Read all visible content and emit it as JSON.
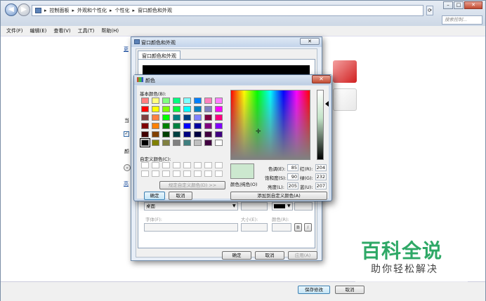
{
  "breadcrumb": [
    "控制面板",
    "外观和个性化",
    "个性化",
    "窗口颜色和外观"
  ],
  "search": {
    "placeholder": "搜索控制..."
  },
  "menu": [
    "文件(F)",
    "编辑(E)",
    "查看(V)",
    "工具(T)",
    "帮助(H)"
  ],
  "main_window": {
    "left_fragments": [
      "更",
      "当",
      "颜",
      "高"
    ],
    "save_label": "保存修改",
    "cancel_label": "取消"
  },
  "appearance_dialog": {
    "title": "窗口颜色和外观",
    "tab": "窗口颜色和外观",
    "item_value": "桌面",
    "font_label": "字体(F):",
    "size_label": "大小(E):",
    "color_label": "颜色(R):",
    "bold_label": "B",
    "italic_label": "I",
    "ok_label": "确定",
    "cancel_label": "取消",
    "apply_label": "应用(A)"
  },
  "color_dialog": {
    "title": "颜色",
    "basic_colors_label": "基本颜色(B):",
    "custom_colors_label": "自定义颜色(C):",
    "define_custom_label": "规定自定义颜色(D) >>",
    "ok_label": "确定",
    "cancel_label": "取消",
    "solid_label": "颜色|纯色(O)",
    "add_custom_label": "添加到自定义颜色(A)",
    "hue_label": "色调(E):",
    "hue_value": "85",
    "sat_label": "饱和度(S):",
    "sat_value": "90",
    "lum_label": "亮度(L):",
    "lum_value": "205",
    "red_label": "红(R):",
    "red_value": "204",
    "green_label": "绿(G):",
    "green_value": "232",
    "blue_label": "蓝(U):",
    "blue_value": "207",
    "basic_colors": [
      "#ff8080",
      "#ffff80",
      "#80ff80",
      "#00ff80",
      "#80ffff",
      "#0080ff",
      "#ff80c0",
      "#ff80ff",
      "#ff0000",
      "#ffff00",
      "#80ff00",
      "#00ff40",
      "#00ffff",
      "#0080c0",
      "#8080c0",
      "#ff00ff",
      "#804040",
      "#ff8040",
      "#00ff00",
      "#008080",
      "#004080",
      "#8080ff",
      "#800040",
      "#ff0080",
      "#800000",
      "#ff8000",
      "#008000",
      "#008040",
      "#0000ff",
      "#0000a0",
      "#800080",
      "#8000ff",
      "#400000",
      "#804000",
      "#004000",
      "#004040",
      "#000080",
      "#000040",
      "#400040",
      "#400080",
      "#000000",
      "#808000",
      "#808040",
      "#808080",
      "#408080",
      "#c0c0c0",
      "#400040",
      "#ffffff"
    ],
    "selected_color": "#cce8cf"
  },
  "watermark": {
    "title": "百科全说",
    "subtitle": "助你轻松解决"
  }
}
